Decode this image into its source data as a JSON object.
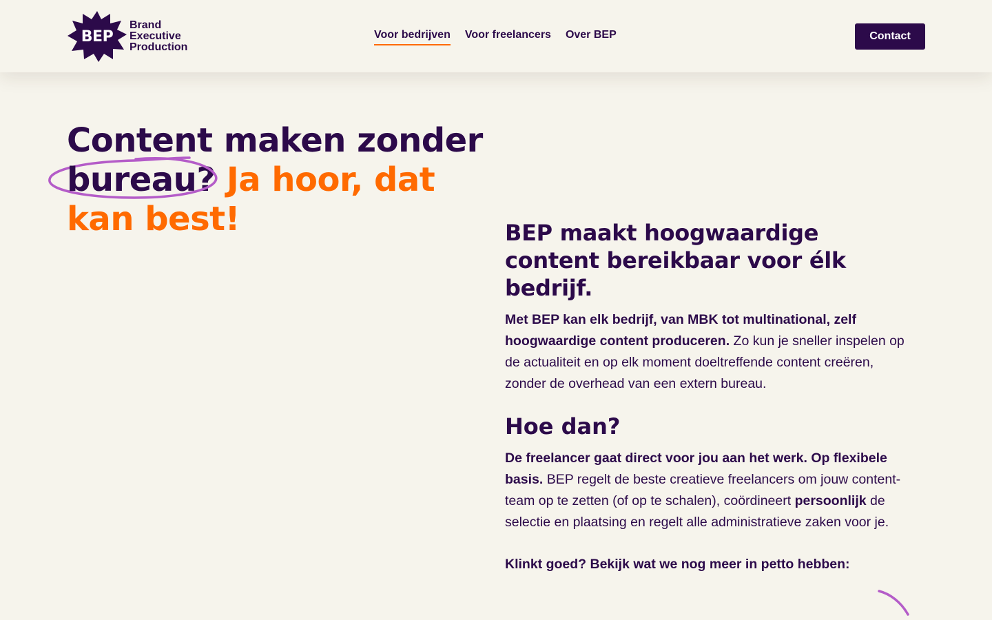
{
  "header": {
    "logo": {
      "badge_text": "BEP",
      "lines": [
        "Brand",
        "Executive",
        "Production"
      ]
    },
    "nav": [
      {
        "label": "Voor bedrijven",
        "active": true
      },
      {
        "label": "Voor freelancers",
        "active": false
      },
      {
        "label": "Over BEP",
        "active": false
      }
    ],
    "contact_label": "Contact"
  },
  "hero": {
    "heading_part1": "Content maken zonder",
    "heading_circled": "bureau",
    "heading_qmark": "?",
    "heading_accent": "Ja hoor, dat kan best!"
  },
  "intro": {
    "title": "BEP maakt hoogwaardige content bereikbaar voor élk bedrijf.",
    "paragraph_bold": "Met BEP kan elk bedrijf, van MBK tot multinational, zelf hoogwaardige content produceren.",
    "paragraph_rest": "Zo kun je sneller inspelen op de actualiteit en op elk moment doeltreffende content creëren, zonder de overhead van een extern bureau."
  },
  "how": {
    "title": "Hoe dan?",
    "bold1": "De freelancer gaat direct voor jou aan het werk. Op flexibele basis.",
    "text1": "BEP regelt de beste creatieve freelancers om jouw content-team op te zetten (of op te schalen), coördineert",
    "bold2": "persoonlijk",
    "text2": "de selectie en plaatsing en regelt alle administratieve zaken voor je."
  },
  "cta_text": "Klinkt goed? Bekijk wat we nog meer in petto hebben:",
  "colors": {
    "brand_purple": "#2c0a4a",
    "accent_orange": "#ff6a00",
    "highlight_lilac": "#b45cc8",
    "background": "#f6f4ec"
  }
}
